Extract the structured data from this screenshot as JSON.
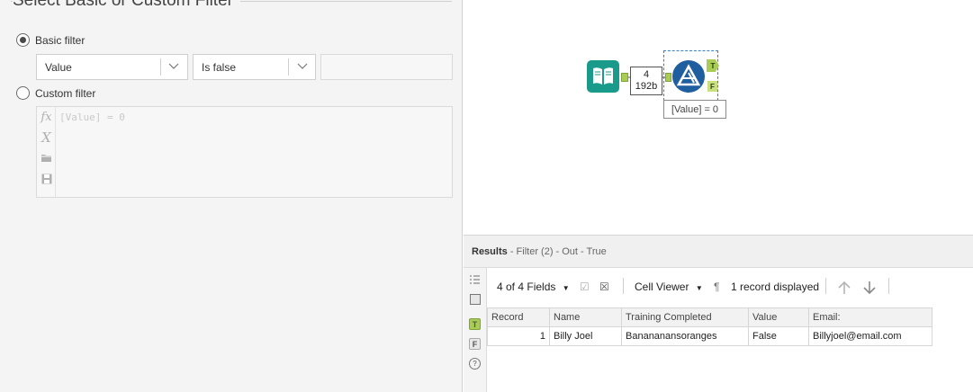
{
  "config": {
    "section_title": "Select Basic or Custom Filter",
    "basic_filter_label": "Basic filter",
    "custom_filter_label": "Custom filter",
    "field_select_value": "Value",
    "operator_select_value": "Is false",
    "value_input": "",
    "expression_text": "[Value] = 0",
    "gutter_icons": [
      "function-icon",
      "variable-icon",
      "open-folder-icon",
      "save-icon"
    ]
  },
  "canvas": {
    "connection_records": "4",
    "connection_size": "192b",
    "true_anchor": "T",
    "false_anchor": "F",
    "annotation": "[Value] = 0"
  },
  "results": {
    "title": "Results",
    "subtitle": "- Filter (2) - Out - True",
    "fields_label": "4 of 4 Fields",
    "viewer_label": "Cell Viewer",
    "records_label": "1 record displayed",
    "side_true": "T",
    "side_false": "F",
    "columns": [
      "Record",
      "Name",
      "Training Completed",
      "Value",
      "Email:"
    ],
    "rows": [
      [
        "1",
        "Billy Joel",
        "Banananansoranges",
        "False",
        "Billyjoel@email.com"
      ]
    ]
  },
  "colors": {
    "accent_teal": "#1a9a8a",
    "filter_blue": "#1f5fa0",
    "anchor_green": "#a8cc55"
  }
}
